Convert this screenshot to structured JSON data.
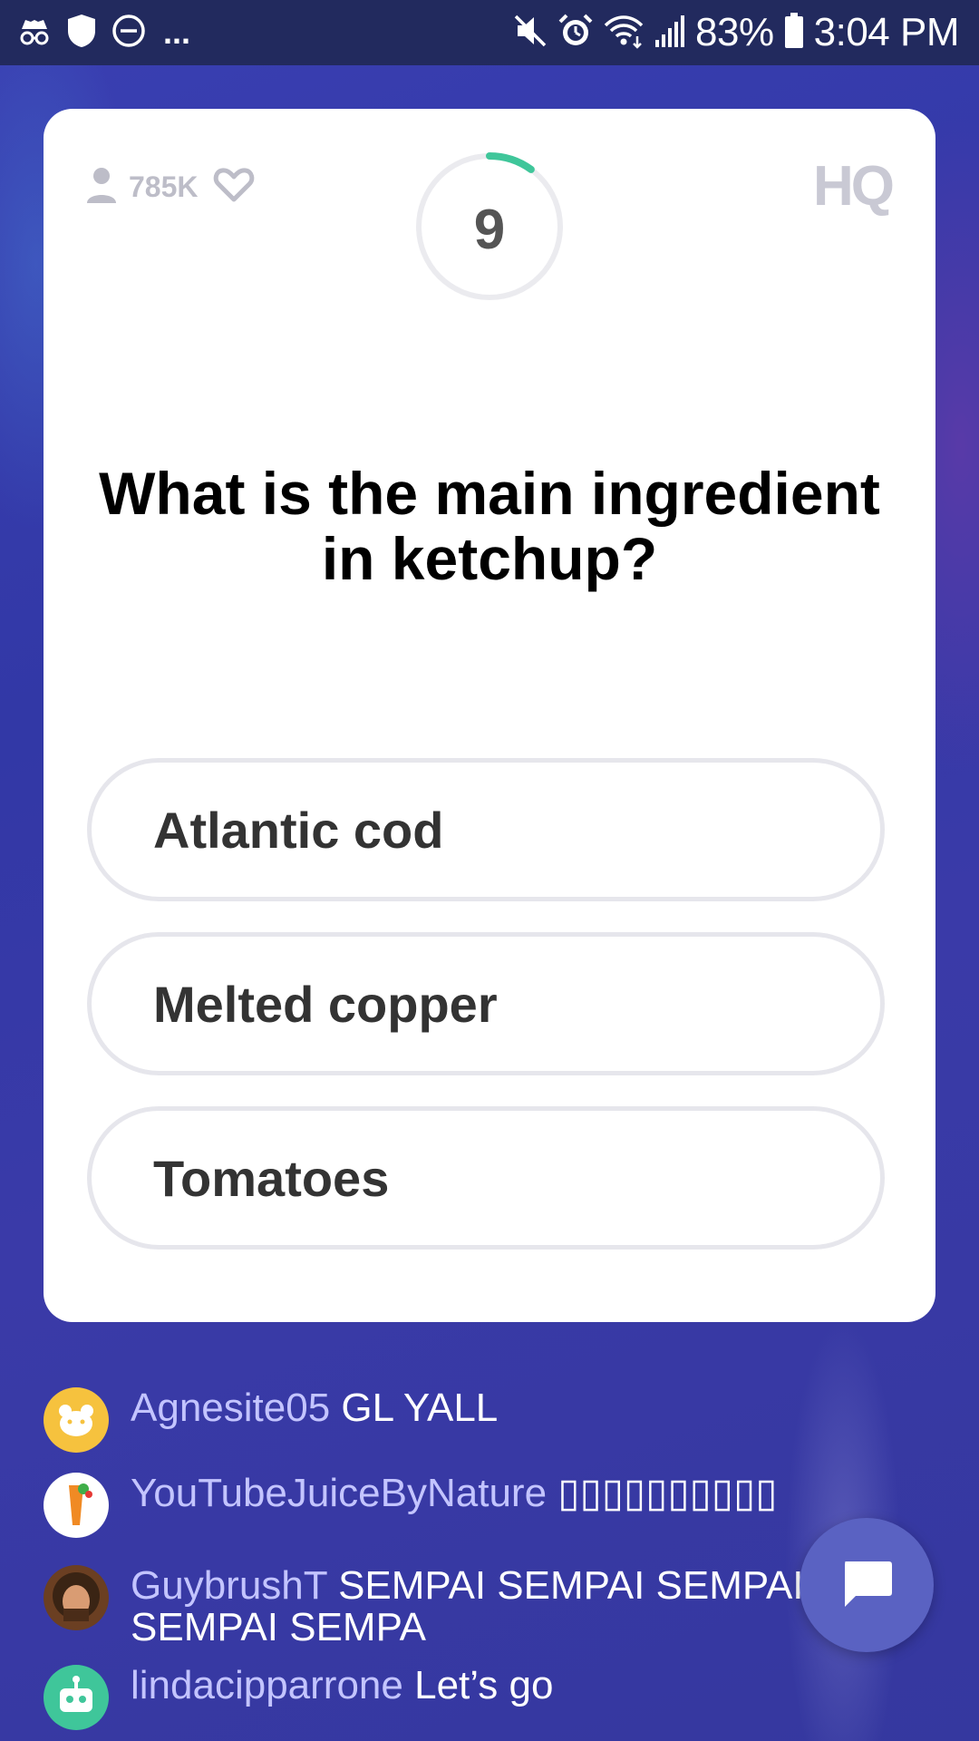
{
  "status_bar": {
    "battery": "83%",
    "time": "3:04 PM",
    "overflow": "..."
  },
  "game": {
    "viewer_count": "785K",
    "timer_seconds": "9",
    "timer_remaining_fraction": 0.1,
    "logo": "HQ",
    "question": "What is the main ingredient in ketchup?",
    "answers": [
      "Atlantic cod",
      "Melted copper",
      "Tomatoes"
    ]
  },
  "chat": {
    "messages": [
      {
        "user": "Agnesite05",
        "text": "GL YALL"
      },
      {
        "user": "YouTubeJuiceByNature",
        "text": "▯▯▯▯▯▯▯▯▯▯"
      },
      {
        "user": "GuybrushT",
        "text": "SEMPAI SEMPAI SEMPAI SEMPAI SEMPA"
      },
      {
        "user": "lindacipparrone",
        "text": "Let’s go"
      }
    ]
  },
  "colors": {
    "accent_timer": "#3fc69a",
    "background": "#3238a6",
    "chat_username": "#c3c4ff"
  }
}
